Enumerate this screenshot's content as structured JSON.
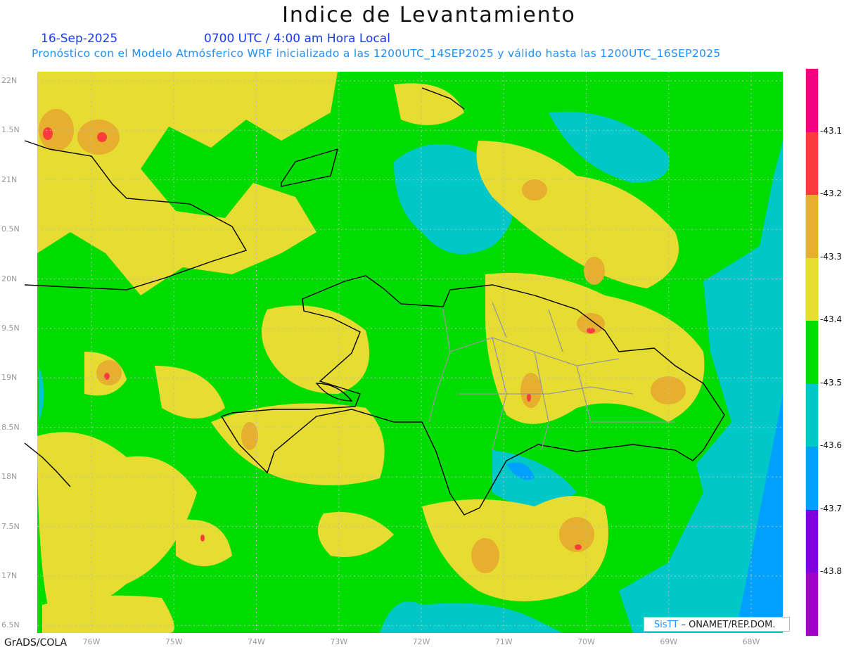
{
  "title": "Indice de Levantamiento",
  "date": "16-Sep-2025",
  "time": "0700 UTC / 4:00 am Hora Local",
  "forecast_note": "Pronóstico con el Modelo Atmósferico WRF inicializado a las 1200UTC_14SEP2025 y válido hasta las  1200UTC_16SEP2025",
  "footer": "GrADS/COLA",
  "credit": {
    "brand": "SisTT",
    "text": "– ONAMET/REP.DOM."
  },
  "y_axis_labels": [
    "22N",
    "1.5N",
    "21N",
    "0.5N",
    "20N",
    "9.5N",
    "19N",
    "8.5N",
    "18N",
    "7.5N",
    "17N",
    "6.5N"
  ],
  "x_axis_labels": [
    "76W",
    "75W",
    "74W",
    "73W",
    "72W",
    "71W",
    "70W",
    "69W",
    "68W"
  ],
  "colorbar": {
    "labels": [
      "-43.1",
      "-43.2",
      "-43.3",
      "-43.4",
      "-43.5",
      "-43.6",
      "-43.7",
      "-43.8"
    ],
    "colors": [
      "#f0047f",
      "#fa3c3c",
      "#e6af2d",
      "#e6dc32",
      "#00dc00",
      "#00c8c8",
      "#00a0ff",
      "#8200dc",
      "#a000c8"
    ]
  }
}
